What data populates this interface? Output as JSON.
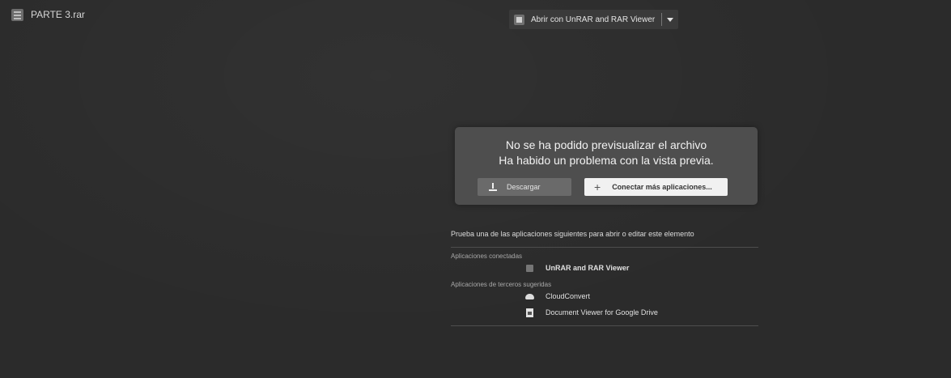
{
  "topbar": {
    "file_name": "PARTE 3.rar",
    "open_with_label": "Abrir con UnRAR and RAR Viewer"
  },
  "error": {
    "line1": "No se ha podido previsualizar el archivo",
    "line2": "Ha habido un problema con la vista previa.",
    "download_label": "Descargar",
    "connect_label": "Conectar más aplicaciones..."
  },
  "suggestions": {
    "title": "Prueba una de las aplicaciones siguientes para abrir o editar este elemento",
    "connected_heading": "Aplicaciones conectadas",
    "connected_apps": [
      {
        "label": "UnRAR and RAR Viewer",
        "icon": "rar-icon"
      }
    ],
    "suggested_heading": "Aplicaciones de terceros sugeridas",
    "suggested_apps": [
      {
        "label": "CloudConvert",
        "icon": "cloud-icon"
      },
      {
        "label": "Document Viewer for Google Drive",
        "icon": "document-icon"
      }
    ]
  },
  "colors": {
    "background": "#2b2b2b",
    "card": "#4e4e4e",
    "primary_button": "#f1f1f1"
  }
}
